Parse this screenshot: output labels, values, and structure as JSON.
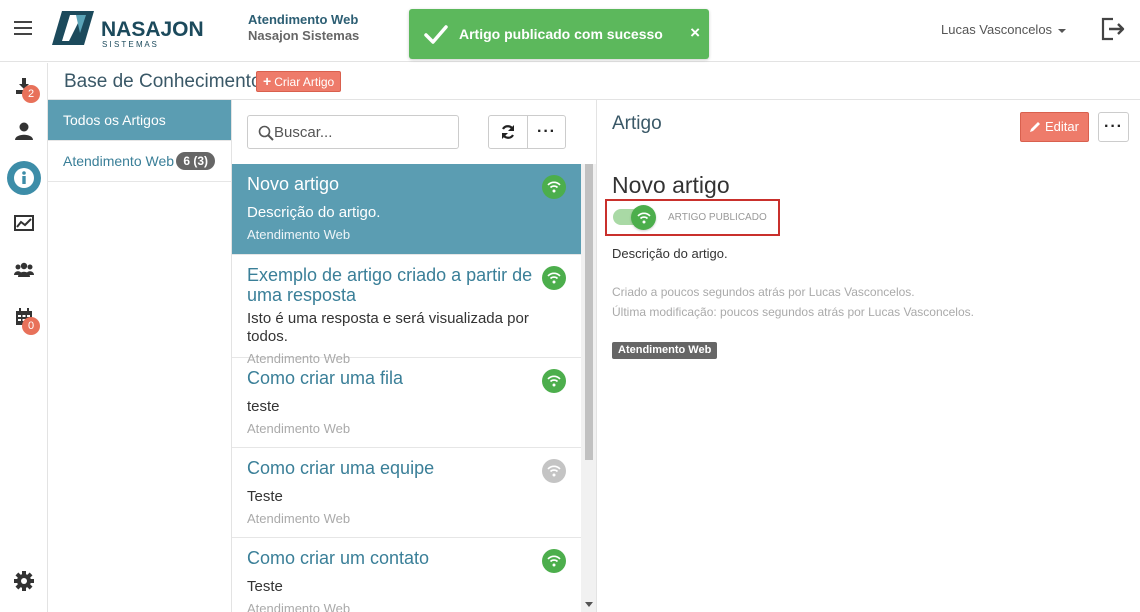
{
  "header": {
    "app_name": "Atendimento Web",
    "company": "Nasajon Sistemas",
    "logo_text": "NASAJON",
    "logo_sub": "S I S T E M A S",
    "user_name": "Lucas Vasconcelos"
  },
  "toast": {
    "message": "Artigo publicado com sucesso",
    "close": "×",
    "color": "#5cb85c"
  },
  "sidebar": {
    "items": [
      {
        "icon": "download-icon",
        "badge": "2"
      },
      {
        "icon": "user-icon"
      },
      {
        "icon": "info-icon",
        "active": true
      },
      {
        "icon": "chart-icon"
      },
      {
        "icon": "users-icon"
      },
      {
        "icon": "calendar-icon",
        "badge": "0"
      },
      {
        "icon": "gear-icon"
      }
    ]
  },
  "page": {
    "title": "Base de Conhecimento",
    "new_button": "Criar Artigo"
  },
  "categories": [
    {
      "label": "Todos os Artigos",
      "active": true
    },
    {
      "label": "Atendimento Web",
      "badge": "6 (3)"
    }
  ],
  "search": {
    "placeholder": "Buscar..."
  },
  "list_more": "···",
  "articles": [
    {
      "title": "Novo artigo",
      "description": "Descrição do artigo.",
      "category": "Atendimento Web",
      "published": true,
      "active": true
    },
    {
      "title": "Exemplo de artigo criado a partir de uma resposta",
      "description": "Isto é uma resposta e será visualizada por todos.",
      "category": "Atendimento Web",
      "published": true
    },
    {
      "title": "Como criar uma fila",
      "description": "teste",
      "category": "Atendimento Web",
      "published": true
    },
    {
      "title": "Como criar uma equipe",
      "description": "Teste",
      "category": "Atendimento Web",
      "published": false
    },
    {
      "title": "Como criar um contato",
      "description": "Teste",
      "category": "Atendimento Web",
      "published": true
    }
  ],
  "detail": {
    "header": "Artigo",
    "edit_button": "Editar",
    "more": "···",
    "title": "Novo artigo",
    "published_label": "ARTIGO PUBLICADO",
    "description": "Descrição do artigo.",
    "created": "Criado a poucos segundos atrás por Lucas Vasconcelos.",
    "modified": "Última modificação: poucos segundos atrás por Lucas Vasconcelos.",
    "tag": "Atendimento Web"
  },
  "colors": {
    "accent": "#3d8da8",
    "primary_button": "#ee7b6a",
    "published": "#4cae4c",
    "unpublished": "#c4c4c4"
  }
}
